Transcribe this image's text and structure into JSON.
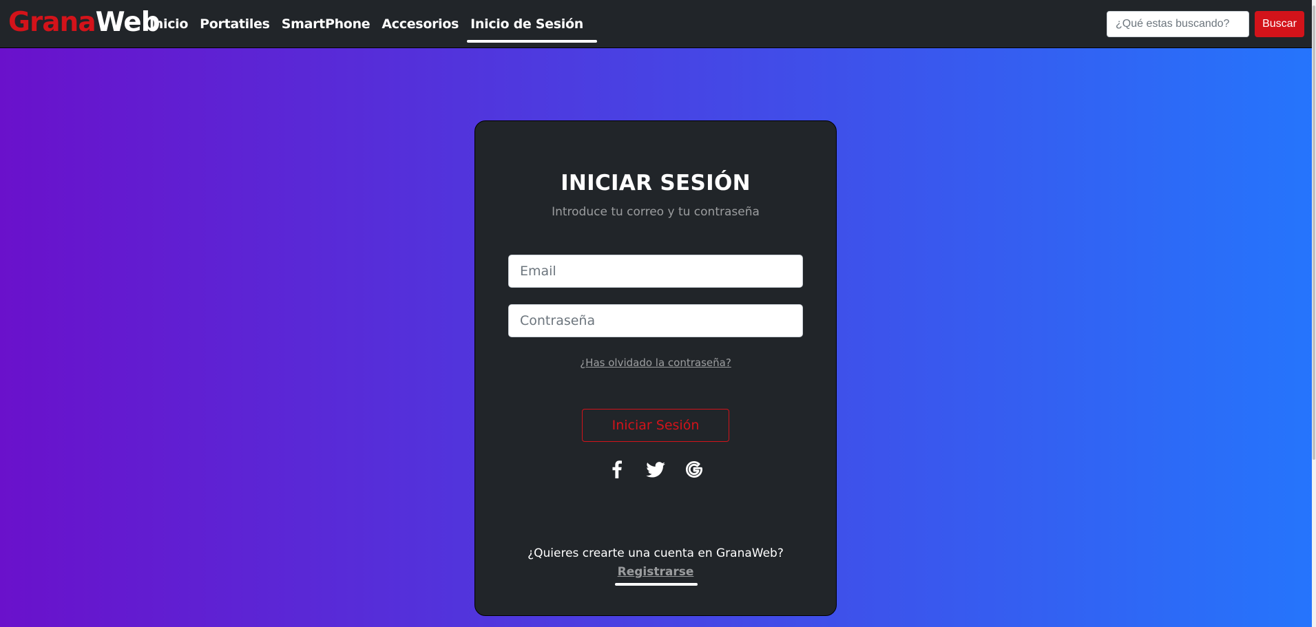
{
  "brand": {
    "part1": "Grana",
    "part2": "Web",
    "accent_color": "#d3131a"
  },
  "nav": {
    "items": [
      {
        "label": "Inicio",
        "active": false
      },
      {
        "label": "Portatiles",
        "active": false
      },
      {
        "label": "SmartPhone",
        "active": false
      },
      {
        "label": "Accesorios",
        "active": false
      },
      {
        "label": "Inicio de Sesión",
        "active": true
      }
    ]
  },
  "search": {
    "placeholder": "¿Qué estas buscando?",
    "value": "",
    "button_label": "Buscar"
  },
  "login": {
    "title": "INICIAR SESIÓN",
    "subtitle": "Introduce tu correo y tu contraseña",
    "email_placeholder": "Email",
    "password_placeholder": "Contraseña",
    "forgot_label": "¿Has olvidado la contraseña?",
    "submit_label": "Iniciar Sesión",
    "social": [
      {
        "icon": "facebook-icon"
      },
      {
        "icon": "twitter-icon"
      },
      {
        "icon": "google-icon"
      }
    ],
    "register_prompt": "¿Quieres crearte una cuenta en GranaWeb?",
    "register_label": "Registrarse"
  },
  "theme": {
    "gradient_start": "#6a11cb",
    "gradient_end": "#2575fc",
    "card_bg": "#212529",
    "accent": "#d3131a"
  }
}
